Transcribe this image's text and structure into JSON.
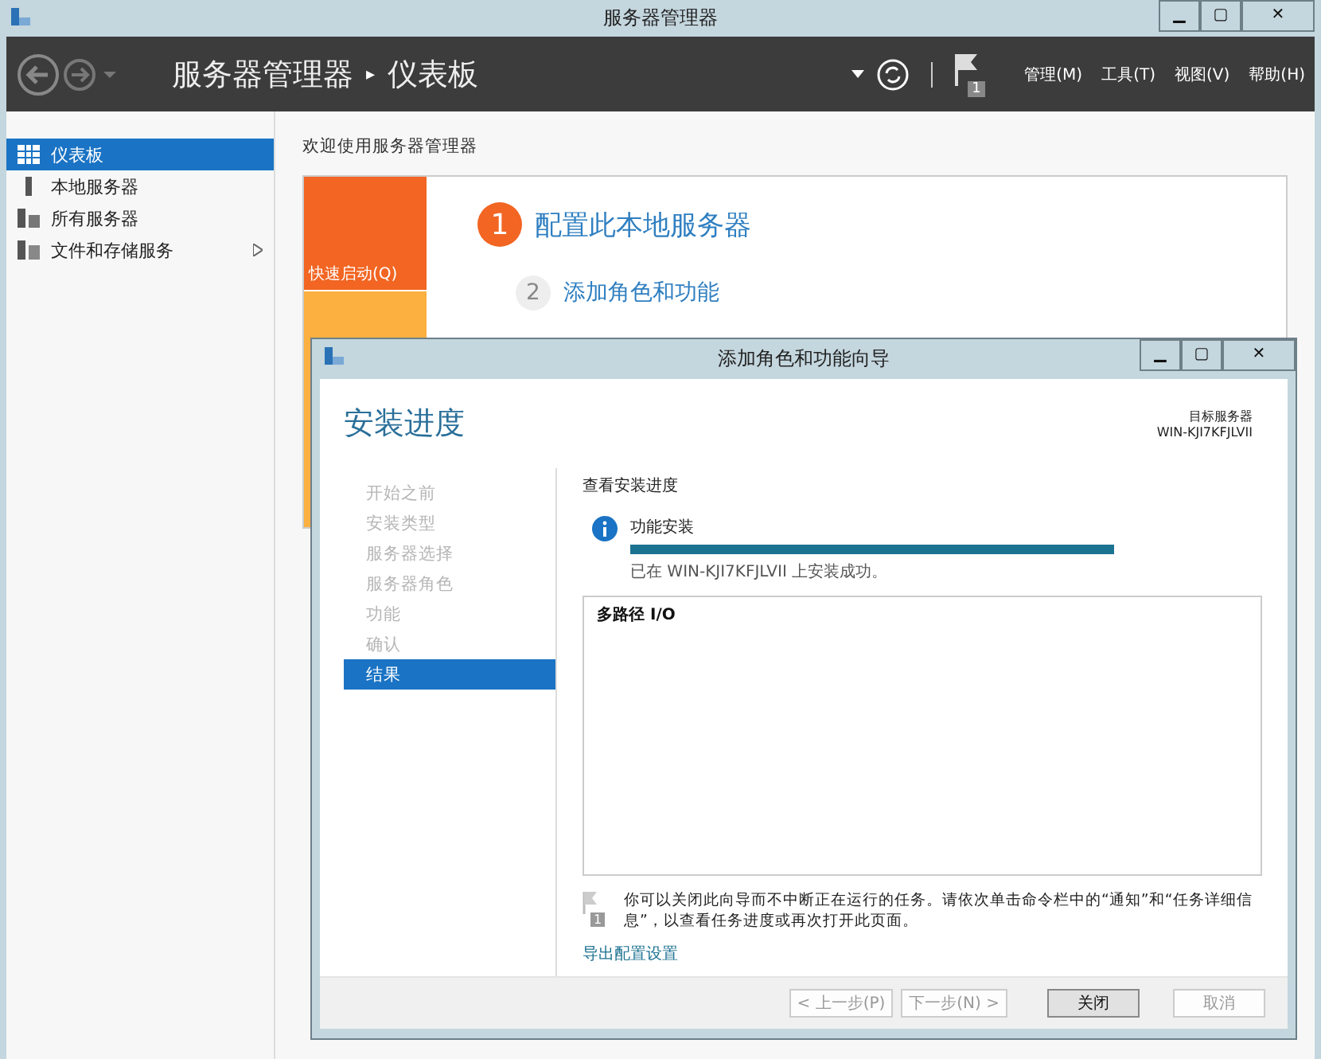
{
  "window": {
    "title": "服务器管理器",
    "controls": [
      "▁",
      "▢",
      "✕"
    ]
  },
  "header": {
    "app": "服务器管理器",
    "separator": "▸",
    "page": "仪表板",
    "notification_count": "1",
    "menus": [
      "管理(M)",
      "工具(T)",
      "视图(V)",
      "帮助(H)"
    ]
  },
  "sidebar": {
    "items": [
      {
        "label": "仪表板",
        "kind": "dashboard",
        "selected": true,
        "expandable": false
      },
      {
        "label": "本地服务器",
        "kind": "server",
        "selected": false,
        "expandable": false
      },
      {
        "label": "所有服务器",
        "kind": "servers",
        "selected": false,
        "expandable": false
      },
      {
        "label": "文件和存储服务",
        "kind": "storage",
        "selected": false,
        "expandable": true
      }
    ]
  },
  "welcome": {
    "heading": "欢迎使用服务器管理器",
    "quick_start": "快速启动(Q)",
    "steps": [
      {
        "number": "1",
        "label": "配置此本地服务器",
        "emphasis": true
      },
      {
        "number": "2",
        "label": "添加角色和功能",
        "emphasis": false
      }
    ]
  },
  "wizard": {
    "title": "添加角色和功能向导",
    "controls": [
      "▁",
      "▢",
      "✕"
    ],
    "heading": "安装进度",
    "target_label": "目标服务器",
    "target_name": "WIN-KJI7KFJLVII",
    "steps": [
      {
        "label": "开始之前",
        "selected": false
      },
      {
        "label": "安装类型",
        "selected": false
      },
      {
        "label": "服务器选择",
        "selected": false
      },
      {
        "label": "服务器角色",
        "selected": false
      },
      {
        "label": "功能",
        "selected": false
      },
      {
        "label": "确认",
        "selected": false
      },
      {
        "label": "结果",
        "selected": true
      }
    ],
    "section_title": "查看安装进度",
    "progress": {
      "label": "功能安装",
      "level": 1.0,
      "status": "已在 WIN-KJI7KFJLVII 上安装成功。"
    },
    "results": [
      "多路径 I/O"
    ],
    "note": "你可以关闭此向导而不中断正在运行的任务。请依次单击命令栏中的“通知”和“任务详细信息”，以查看任务进度或再次打开此页面。",
    "note_badge": "1",
    "export_link": "导出配置设置",
    "buttons": [
      {
        "label": "< 上一步(P)",
        "disabled": true,
        "primary": false
      },
      {
        "label": "下一步(N) >",
        "disabled": true,
        "primary": false
      },
      {
        "label": "关闭",
        "disabled": false,
        "primary": true
      },
      {
        "label": "取消",
        "disabled": true,
        "primary": false
      }
    ]
  }
}
